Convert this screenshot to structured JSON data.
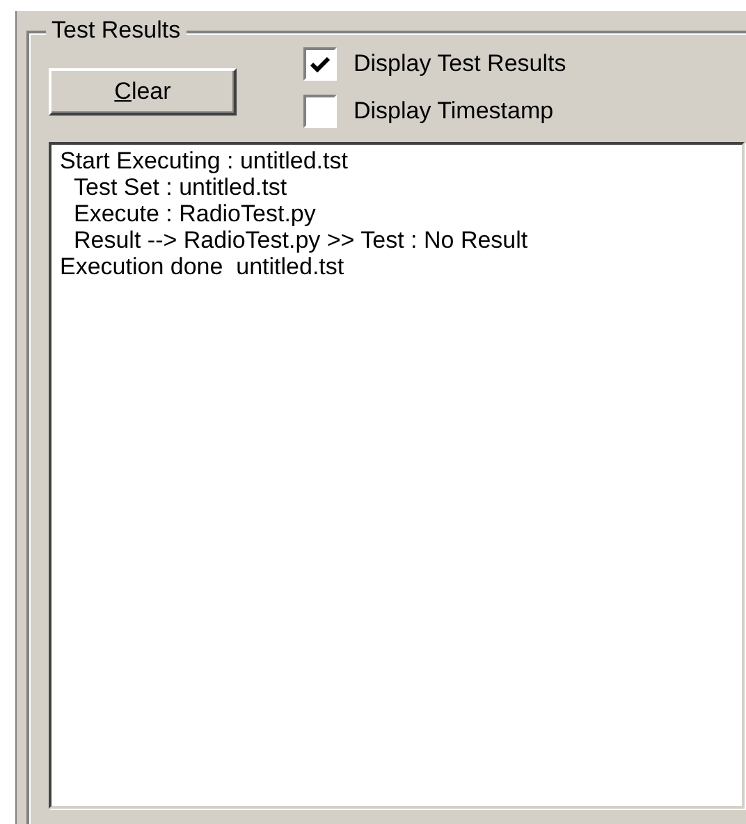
{
  "group": {
    "title": "Test Results"
  },
  "clear_button": {
    "label": "Clear"
  },
  "options": [
    {
      "label": "Display Test Results",
      "checked": true
    },
    {
      "label": "Display Timestamp",
      "checked": false
    }
  ],
  "log": [
    {
      "text": "Start Executing : untitled.tst",
      "children": [
        {
          "text": "Test Set : untitled.tst"
        },
        {
          "text": "Execute : RadioTest.py"
        },
        {
          "text": "Result --> RadioTest.py >> Test : No Result"
        }
      ]
    },
    {
      "text": "Execution done  untitled.tst"
    }
  ]
}
